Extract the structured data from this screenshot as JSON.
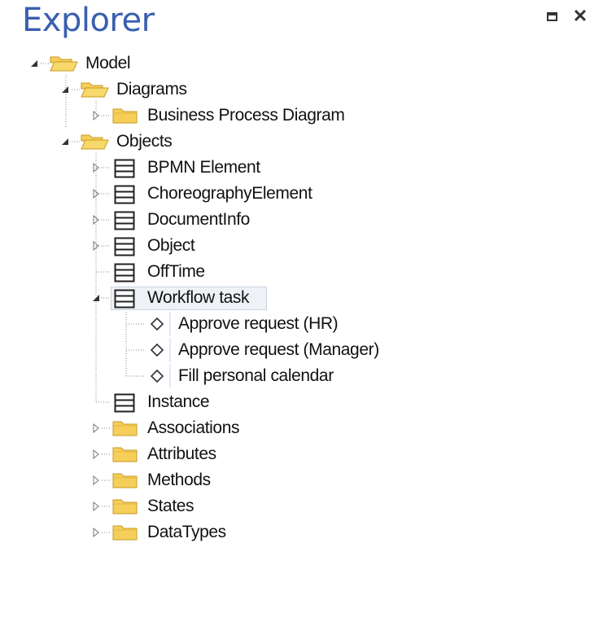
{
  "window": {
    "title": "Explorer",
    "maximize_icon": "maximize-icon",
    "close_icon": "close-icon"
  },
  "tree": {
    "model": "Model",
    "diagrams": "Diagrams",
    "business_process_diagram": "Business Process Diagram",
    "objects": "Objects",
    "bpmn_element": "BPMN Element",
    "choreography_element": "ChoreographyElement",
    "document_info": "DocumentInfo",
    "object": "Object",
    "off_time": "OffTime",
    "workflow_task": "Workflow task",
    "approve_hr": "Approve request (HR)",
    "approve_manager": "Approve request (Manager)",
    "fill_calendar": "Fill personal calendar",
    "instance": "Instance",
    "associations": "Associations",
    "attributes": "Attributes",
    "methods": "Methods",
    "states": "States",
    "data_types": "DataTypes"
  },
  "colors": {
    "title": "#3a5fb0",
    "folder_fill": "#f5cf5a",
    "folder_stroke": "#c89a22",
    "selected_bg": "#eef2f7"
  }
}
